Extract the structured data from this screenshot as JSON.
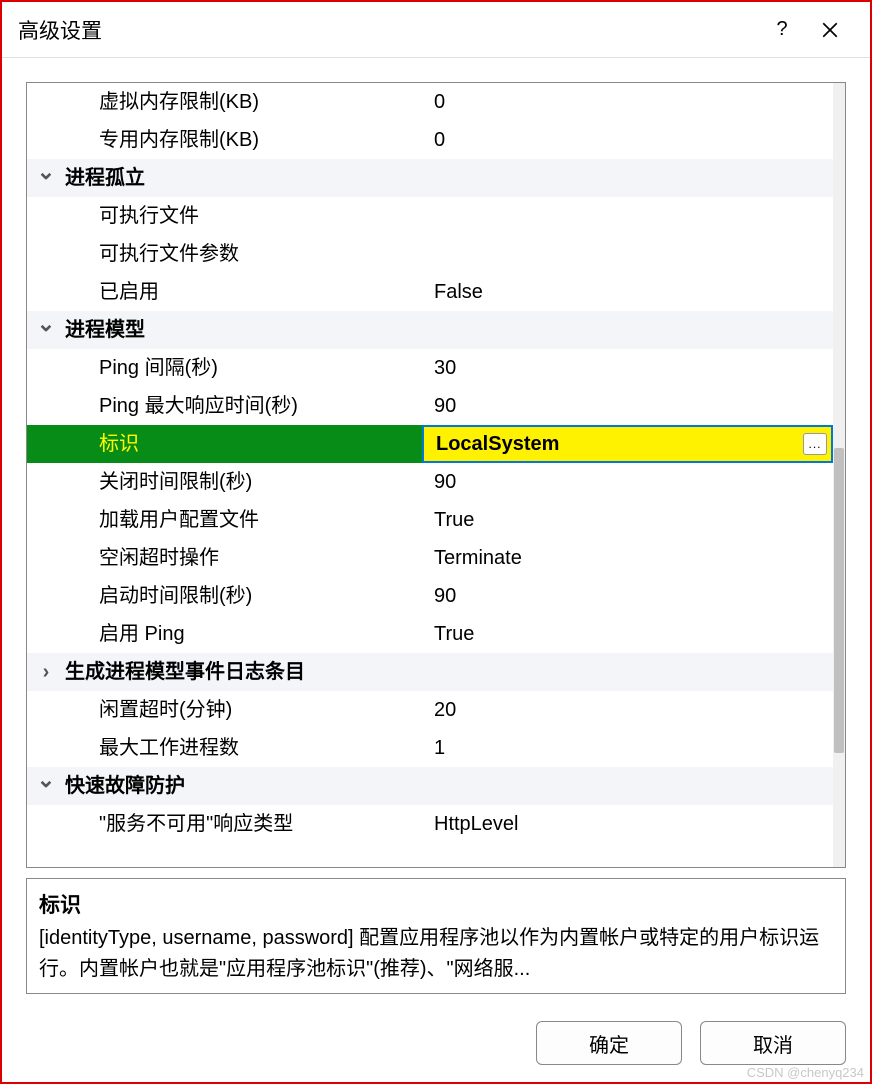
{
  "titlebar": {
    "title": "高级设置",
    "help": "?",
    "close": "✕"
  },
  "rows": [
    {
      "type": "item",
      "label": "虚拟内存限制(KB)",
      "value": "0"
    },
    {
      "type": "item",
      "label": "专用内存限制(KB)",
      "value": "0"
    },
    {
      "type": "cat",
      "label": "进程孤立",
      "expanded": true
    },
    {
      "type": "item",
      "label": "可执行文件",
      "value": ""
    },
    {
      "type": "item",
      "label": "可执行文件参数",
      "value": ""
    },
    {
      "type": "item",
      "label": "已启用",
      "value": "False"
    },
    {
      "type": "cat",
      "label": "进程模型",
      "expanded": true
    },
    {
      "type": "item",
      "label": "Ping 间隔(秒)",
      "value": "30"
    },
    {
      "type": "item",
      "label": "Ping 最大响应时间(秒)",
      "value": "90"
    },
    {
      "type": "item",
      "label": "标识",
      "value": "LocalSystem",
      "selected": true,
      "ellipsis": true
    },
    {
      "type": "item",
      "label": "关闭时间限制(秒)",
      "value": "90"
    },
    {
      "type": "item",
      "label": "加载用户配置文件",
      "value": "True"
    },
    {
      "type": "item",
      "label": "空闲超时操作",
      "value": "Terminate"
    },
    {
      "type": "item",
      "label": "启动时间限制(秒)",
      "value": "90"
    },
    {
      "type": "item",
      "label": "启用 Ping",
      "value": "True"
    },
    {
      "type": "cat",
      "label": "生成进程模型事件日志条目",
      "expanded": false
    },
    {
      "type": "item",
      "label": "闲置超时(分钟)",
      "value": "20"
    },
    {
      "type": "item",
      "label": "最大工作进程数",
      "value": "1"
    },
    {
      "type": "cat",
      "label": "快速故障防护",
      "expanded": true
    },
    {
      "type": "item",
      "label": "\"服务不可用\"响应类型",
      "value": "HttpLevel"
    }
  ],
  "description": {
    "title": "标识",
    "text": "[identityType, username, password] 配置应用程序池以作为内置帐户或特定的用户标识运行。内置帐户也就是\"应用程序池标识\"(推荐)、\"网络服..."
  },
  "buttons": {
    "ok": "确定",
    "cancel": "取消"
  },
  "watermark": "CSDN @chenyq234",
  "icons": {
    "chevron_down": "⌄",
    "chevron_right": "›",
    "ellipsis": "..."
  }
}
